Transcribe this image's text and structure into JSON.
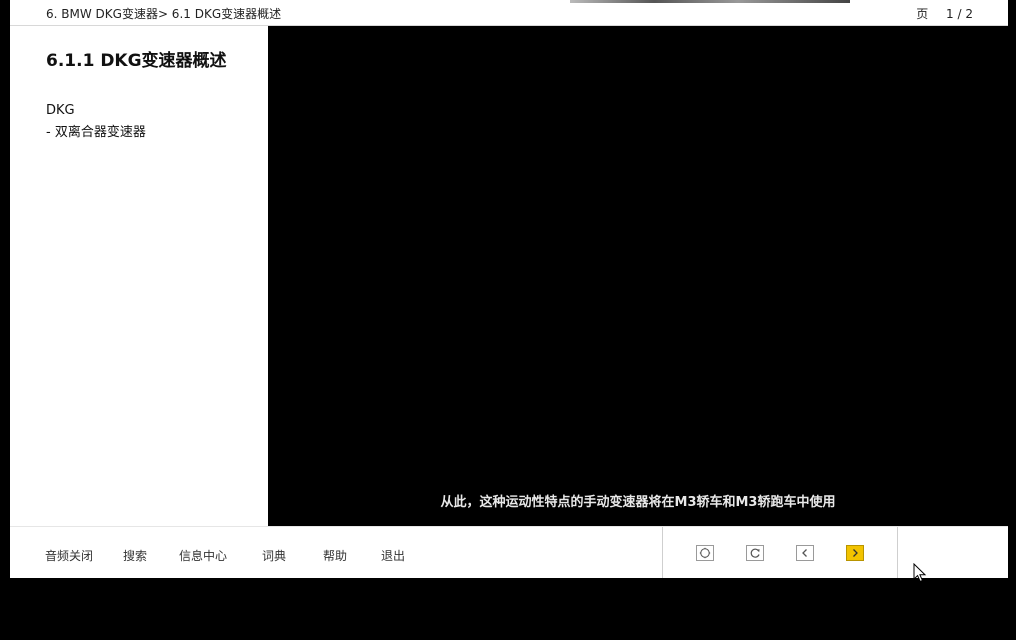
{
  "header": {
    "breadcrumb": "6. BMW DKG变速器> 6.1  DKG变速器概述",
    "page_label": "页",
    "page_value": "1 / 2"
  },
  "content": {
    "section_title": "6.1.1 DKG变速器概述",
    "body_lines": [
      "DKG",
      "- 双离合器变速器"
    ]
  },
  "media": {
    "subtitle": "从此，这种运动性特点的手动变速器将在M3轿车和M3轿跑车中使用"
  },
  "toolbar": {
    "items": [
      "音频关闭",
      "搜索",
      "信息中心",
      "词典",
      "帮助",
      "退出"
    ],
    "nav_buttons": [
      {
        "name": "fullscreen",
        "icon": "fullscreen-icon"
      },
      {
        "name": "replay",
        "icon": "replay-icon"
      },
      {
        "name": "previous",
        "icon": "chevron-left-icon"
      },
      {
        "name": "next",
        "icon": "chevron-right-icon"
      }
    ]
  },
  "colors": {
    "accent": "#f2c300",
    "background": "#000000",
    "panel": "#ffffff"
  }
}
